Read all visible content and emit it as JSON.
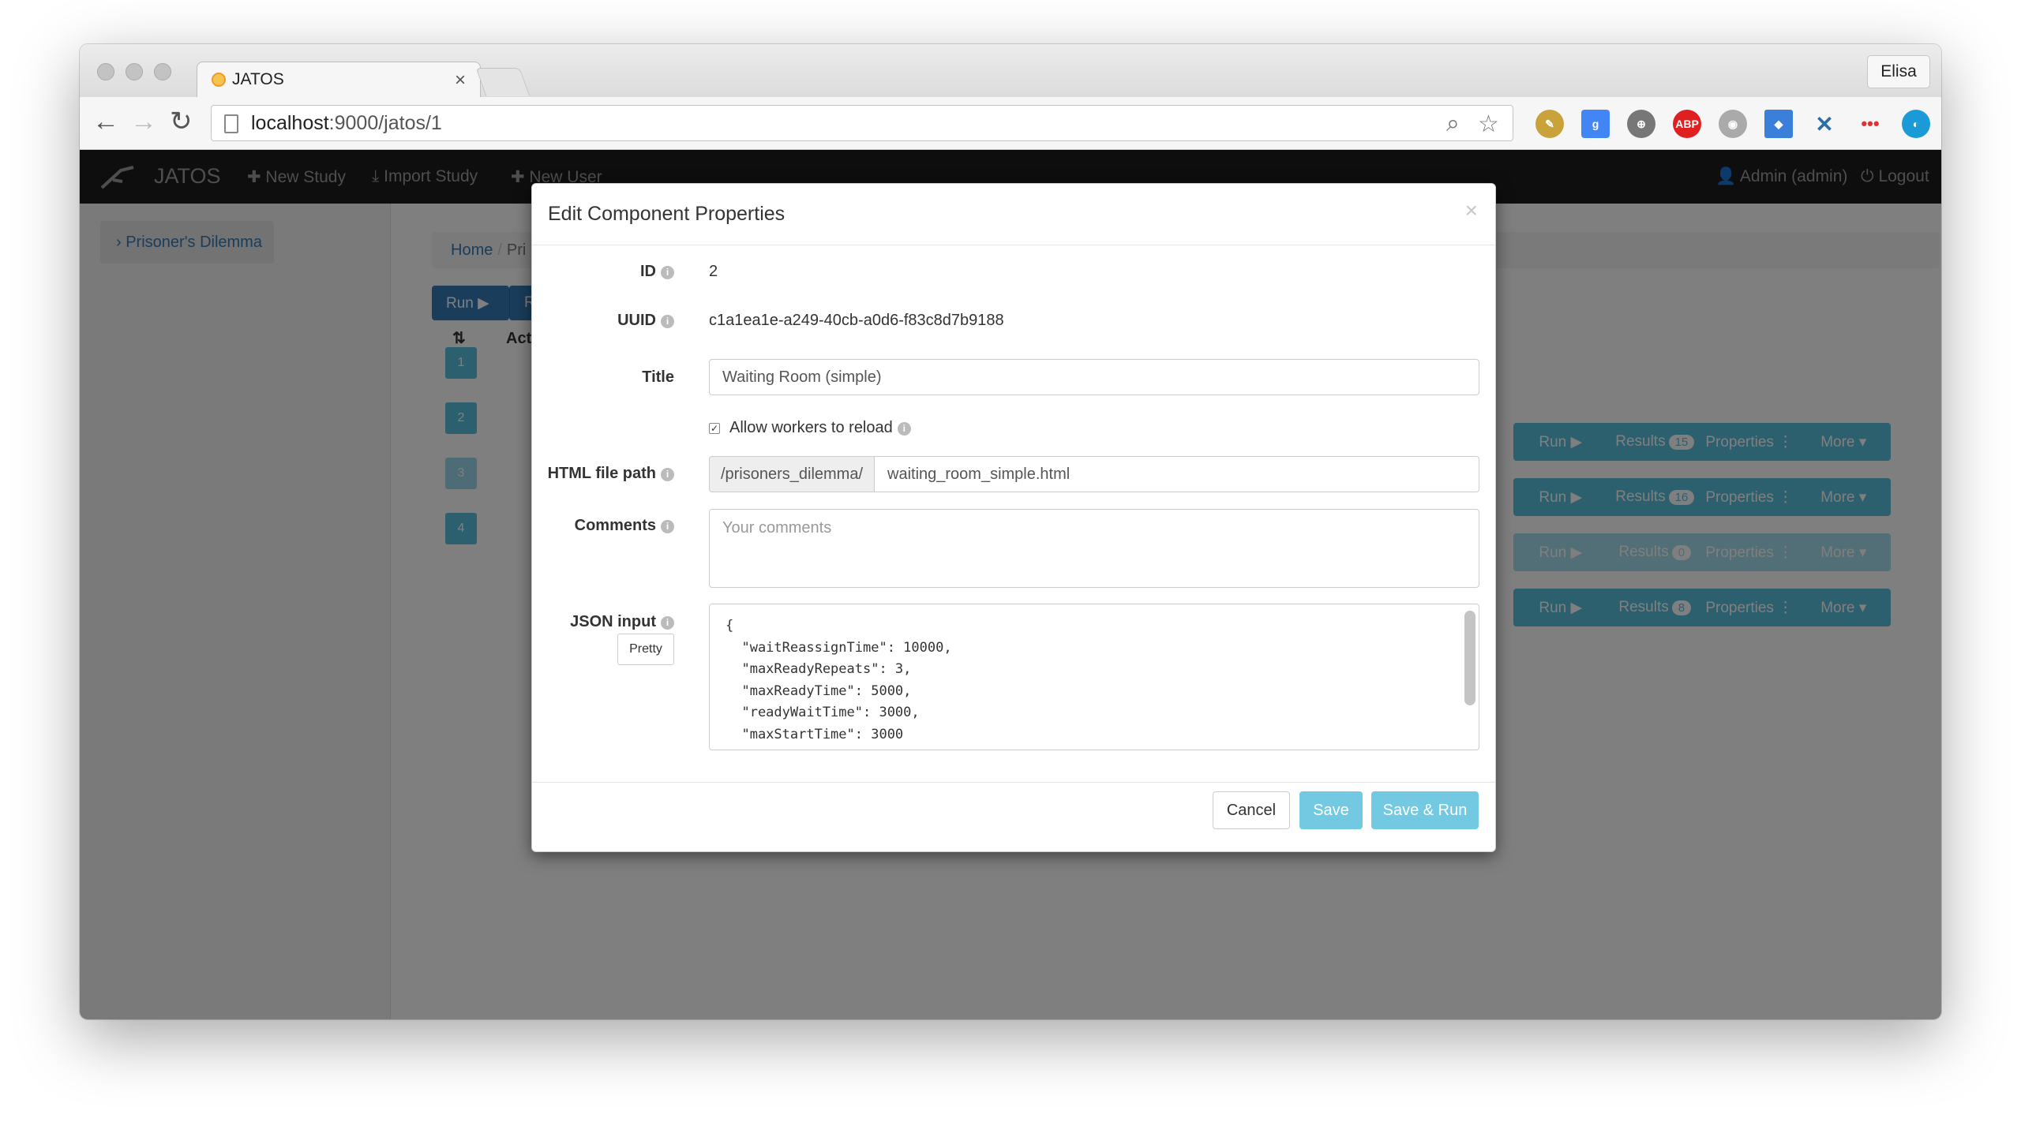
{
  "browser": {
    "tab_title": "JATOS",
    "tab_close": "×",
    "profile": "Elisa",
    "url_host": "localhost",
    "url_path": ":9000/jatos/1"
  },
  "app": {
    "brand": "JATOS",
    "nav": {
      "new_study": "✚ New Study",
      "import_study": "⤓ Import Study",
      "new_user": "✚ New User",
      "user": "👤 Admin (admin)",
      "logout": "⏻ Logout"
    },
    "sidebar": {
      "study_link": "› Prisoner's Dilemma"
    },
    "breadcrumb": {
      "home": "Home",
      "separator": "/",
      "current": "Pri"
    },
    "toolbar": {
      "run": "Run ▶",
      "second": "R"
    },
    "table": {
      "order_header": "⇅",
      "actions_header": "Act"
    },
    "components": [
      {
        "position": "1",
        "run": "Run ▶",
        "results": "Results",
        "results_count": "15",
        "properties": "Properties ⋮",
        "more": "More ▾",
        "active": true
      },
      {
        "position": "2",
        "run": "Run ▶",
        "results": "Results",
        "results_count": "16",
        "properties": "Properties ⋮",
        "more": "More ▾",
        "active": true
      },
      {
        "position": "3",
        "run": "Run ▶",
        "results": "Results",
        "results_count": "0",
        "properties": "Properties ⋮",
        "more": "More ▾",
        "active": false
      },
      {
        "position": "4",
        "run": "Run ▶",
        "results": "Results",
        "results_count": "8",
        "properties": "Properties ⋮",
        "more": "More ▾",
        "active": true
      }
    ]
  },
  "modal": {
    "title": "Edit Component Properties",
    "close": "×",
    "id_label": "ID",
    "id_value": "2",
    "uuid_label": "UUID",
    "uuid_value": "c1a1ea1e-a249-40cb-a0d6-f83c8d7b9188",
    "title_label": "Title",
    "title_value": "Waiting Room (simple)",
    "reload_label": "Allow workers to reload",
    "reload_checked": true,
    "html_label": "HTML file path",
    "html_prefix": "/prisoners_dilemma/",
    "html_value": "waiting_room_simple.html",
    "comments_label": "Comments",
    "comments_placeholder": "Your comments",
    "json_label": "JSON input",
    "pretty_button": "Pretty",
    "json_value": "{\n  \"waitReassignTime\": 10000,\n  \"maxReadyRepeats\": 3,\n  \"maxReadyTime\": 5000,\n  \"readyWaitTime\": 3000,\n  \"maxStartTime\": 3000",
    "cancel": "Cancel",
    "save": "Save",
    "save_run": "Save & Run"
  },
  "colors": {
    "primary": "#337ab7",
    "info": "#5bc0de",
    "navbar": "#1d1d1d"
  }
}
